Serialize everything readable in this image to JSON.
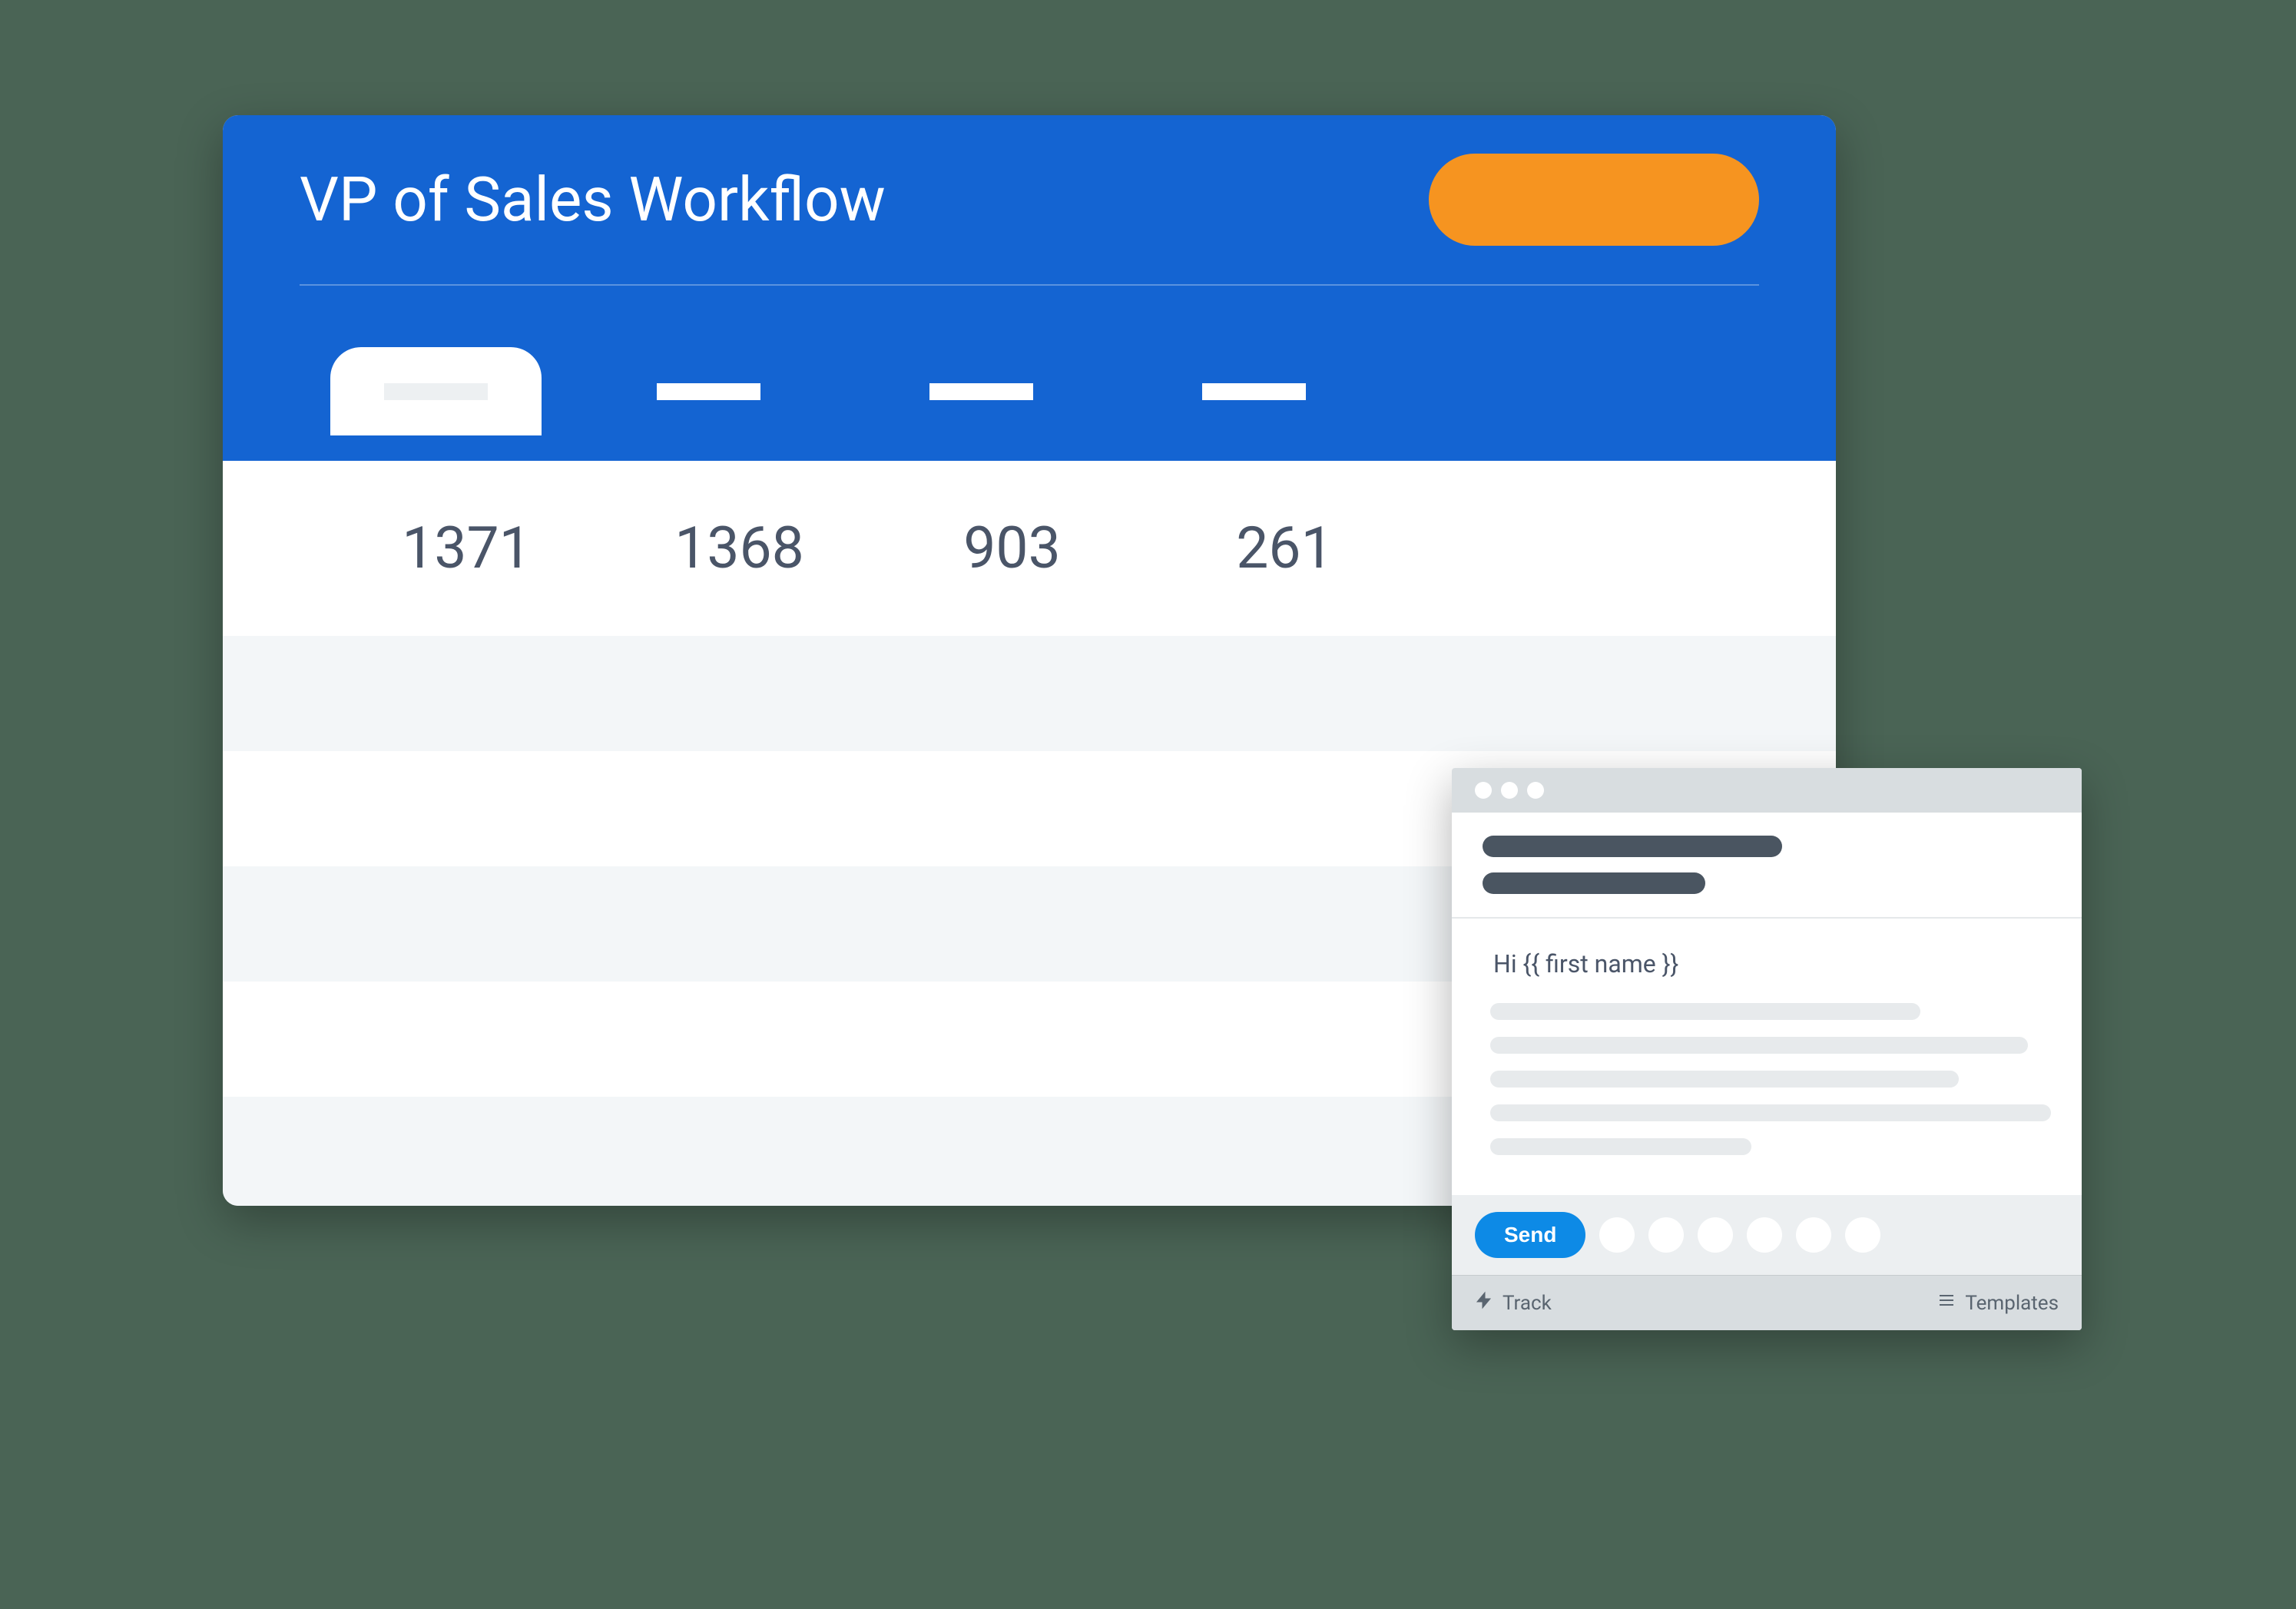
{
  "workflow": {
    "title": "VP of Sales Workflow",
    "action_button_label": "",
    "tabs": [
      {
        "label": "",
        "active": true
      },
      {
        "label": "",
        "active": false
      },
      {
        "label": "",
        "active": false
      },
      {
        "label": "",
        "active": false
      }
    ],
    "stats": [
      {
        "value": "1371"
      },
      {
        "value": "1368"
      },
      {
        "value": "903"
      },
      {
        "value": "261"
      }
    ]
  },
  "email": {
    "greeting": "Hi {{ first name }}",
    "send_label": "Send",
    "track_label": "Track",
    "templates_label": "Templates"
  }
}
